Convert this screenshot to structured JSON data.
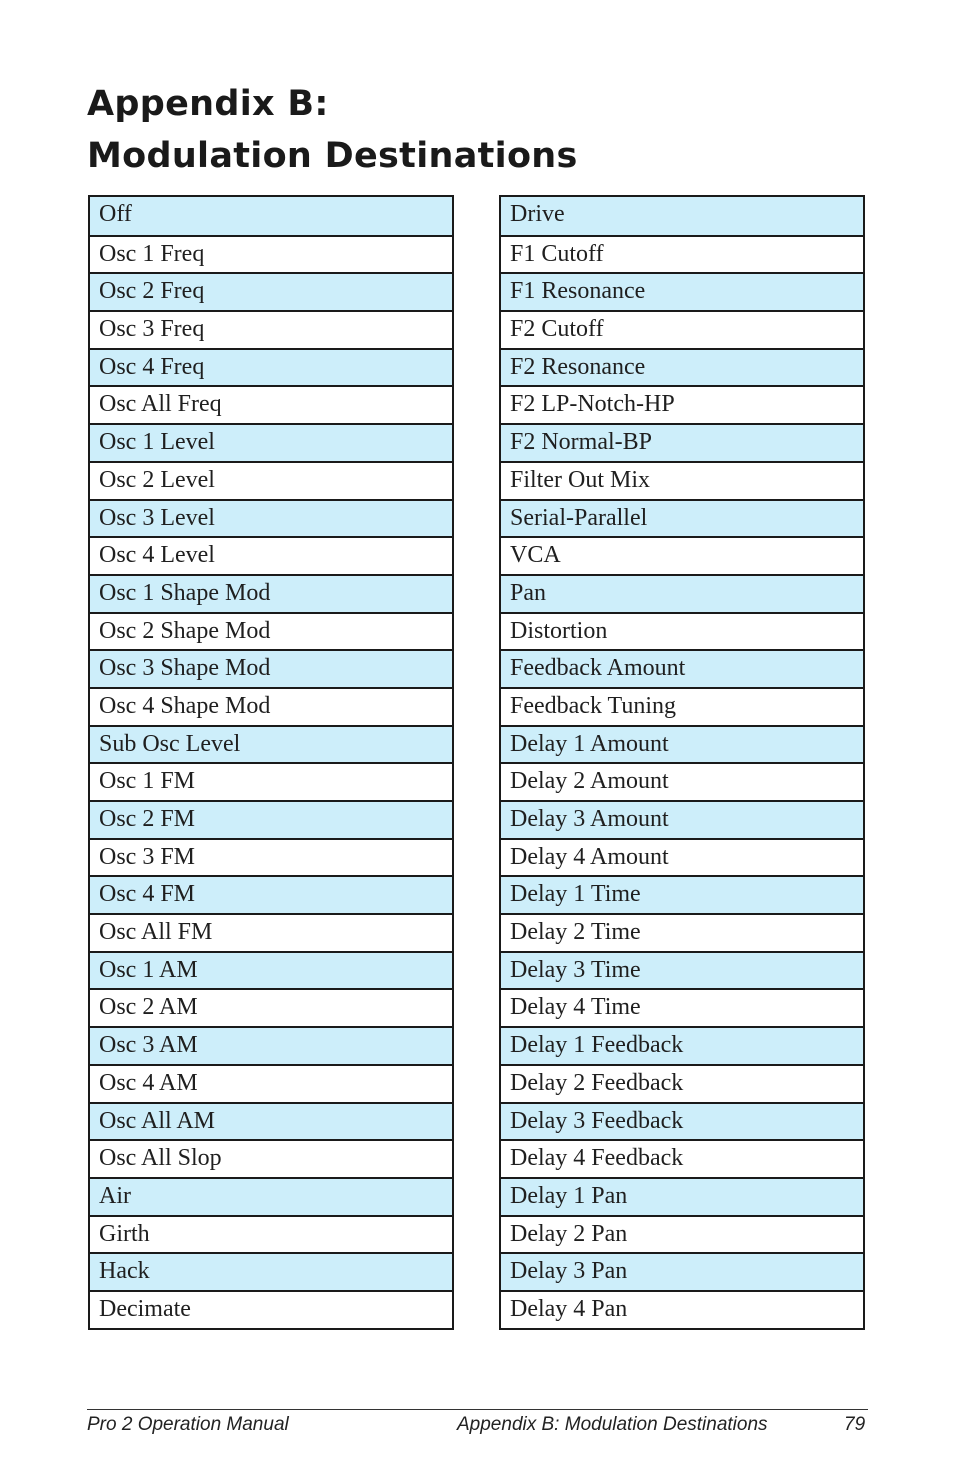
{
  "title": {
    "line1": "Appendix B:",
    "line2": "Modulation Destinations"
  },
  "colors": {
    "shaded_row": "#cdeefa",
    "border": "#1a1a1a"
  },
  "tables": {
    "left": [
      "Off",
      "Osc 1 Freq",
      "Osc 2 Freq",
      "Osc 3 Freq",
      "Osc 4 Freq",
      "Osc All Freq",
      "Osc 1 Level",
      "Osc 2 Level",
      "Osc 3 Level",
      "Osc 4 Level",
      "Osc 1 Shape Mod",
      "Osc 2 Shape Mod",
      "Osc 3 Shape Mod",
      "Osc 4 Shape Mod",
      "Sub Osc Level",
      "Osc 1 FM",
      "Osc 2 FM",
      "Osc 3 FM",
      "Osc 4 FM",
      "Osc All FM",
      "Osc 1 AM",
      "Osc 2 AM",
      "Osc 3 AM",
      "Osc 4 AM",
      "Osc All AM",
      "Osc All Slop",
      "Air",
      "Girth",
      "Hack",
      "Decimate"
    ],
    "right": [
      "Drive",
      "F1 Cutoff",
      "F1 Resonance",
      "F2 Cutoff",
      "F2 Resonance",
      "F2 LP-Notch-HP",
      "F2 Normal-BP",
      "Filter Out Mix",
      "Serial-Parallel",
      "VCA",
      "Pan",
      "Distortion",
      "Feedback Amount",
      "Feedback Tuning",
      "Delay 1 Amount",
      "Delay 2 Amount",
      "Delay 3 Amount",
      "Delay 4 Amount",
      "Delay 1 Time",
      "Delay 2 Time",
      "Delay 3 Time",
      "Delay 4 Time",
      "Delay 1 Feedback",
      "Delay 2 Feedback",
      "Delay 3 Feedback",
      "Delay 4 Feedback",
      "Delay 1 Pan",
      "Delay 2 Pan",
      "Delay 3 Pan",
      "Delay 4 Pan"
    ]
  },
  "footer": {
    "manual": "Pro 2 Operation Manual",
    "section": "Appendix B: Modulation Destinations",
    "page": "79"
  }
}
